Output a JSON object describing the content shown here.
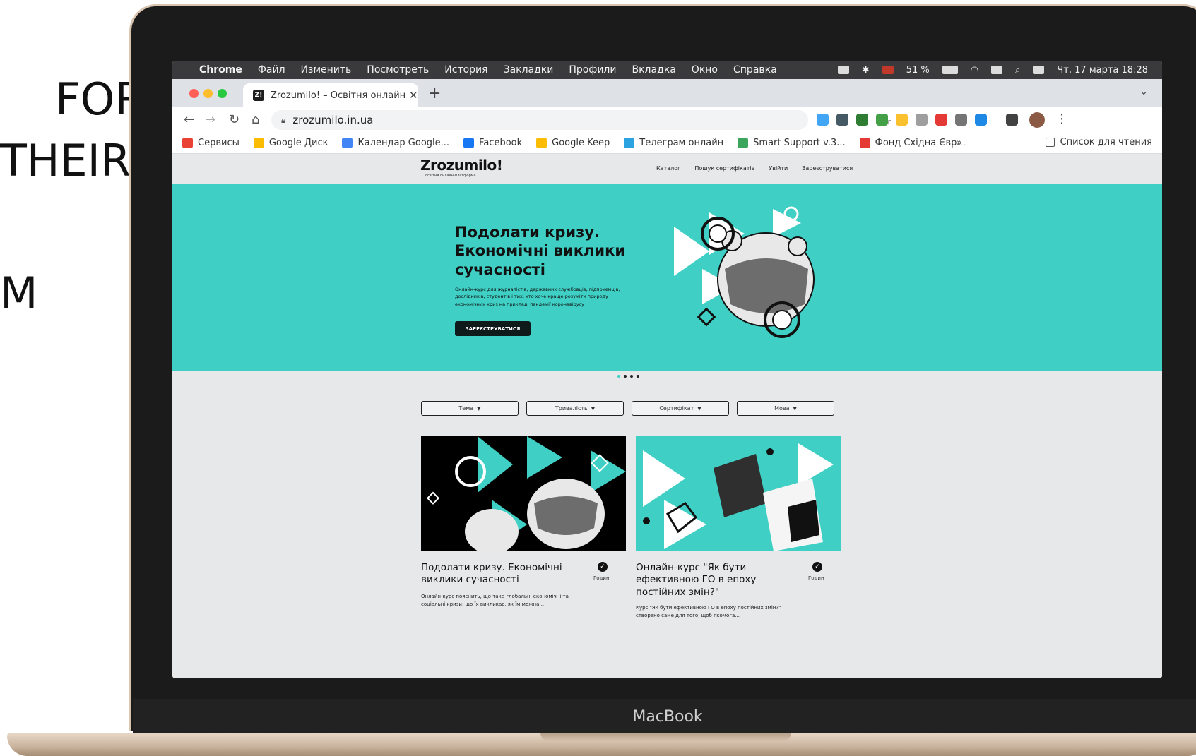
{
  "slide_text": {
    "line1": "FOR",
    "line2": "THEIR",
    "line3": "M"
  },
  "device": {
    "brand": "MacBook"
  },
  "menubar": {
    "app": "Chrome",
    "items": [
      "Файл",
      "Изменить",
      "Посмотреть",
      "История",
      "Закладки",
      "Профили",
      "Вкладка",
      "Окно",
      "Справка"
    ],
    "battery": "51 %",
    "datetime": "Чт, 17 марта 18:28"
  },
  "browser": {
    "tab_favicon": "Z!",
    "tab_title": "Zrozumilo! – Освітня онлайн-",
    "url": "zrozumilo.in.ua",
    "bookmarks": [
      {
        "label": "Сервисы",
        "color": "#e94235"
      },
      {
        "label": "Google Диск",
        "color": "#fbbc04"
      },
      {
        "label": "Календар Google...",
        "color": "#4285f4"
      },
      {
        "label": "Facebook",
        "color": "#1877f2"
      },
      {
        "label": "Google Keep",
        "color": "#fbbc04"
      },
      {
        "label": "Телеграм онлайн",
        "color": "#2aa3e0"
      },
      {
        "label": "Smart Support v.3...",
        "color": "#3ba55c"
      },
      {
        "label": "Фонд Східна Євр...",
        "color": "#e53935"
      }
    ],
    "bookmarks_more": "»",
    "reading_list": "Список для чтения",
    "extension_colors": [
      "#42a5f5",
      "#455a64",
      "#2e7d32",
      "#43a047",
      "#fbc02d",
      "#9e9e9e",
      "#e53935",
      "#757575",
      "#1e88e5",
      "#424242"
    ]
  },
  "site": {
    "logo": "Zrozumilo!",
    "logo_sub": "освітня онлайн-платформа",
    "nav": [
      "Каталог",
      "Пошук сертифікатів",
      "Увійти",
      "Зареєструватися"
    ],
    "hero": {
      "title": "Подолати кризу. Економічні виклики сучасності",
      "description": "Онлайн-курс для журналістів, державних службовців, підприємців, дослідників, студентів і тих, хто хоче краще розуміти природу економічних криз на прикладі пандемії коронавірусу",
      "cta": "ЗАРЕЄСТРУВАТИСЯ",
      "accent_color": "#3fcfc4"
    },
    "carousel": {
      "slides": 4,
      "active": 1
    },
    "filters": [
      "Тема",
      "Тривалість",
      "Сертифікат",
      "Мова"
    ],
    "courses": [
      {
        "title": "Подолати кризу. Економічні виклики сучасності",
        "hours_label": "Годин",
        "description": "Онлайн-курс пояснить, що таке глобальні економічні та соціальні кризи, що їх викликає, як їм можна..."
      },
      {
        "title": "Онлайн-курс \"Як бути ефективною ГО в епоху постійних змін?\"",
        "hours_label": "Годин",
        "description": "Курс \"Як бути ефективною ГО в епоху постійних змін?\" створено саме для того, щоб якомога..."
      }
    ]
  }
}
